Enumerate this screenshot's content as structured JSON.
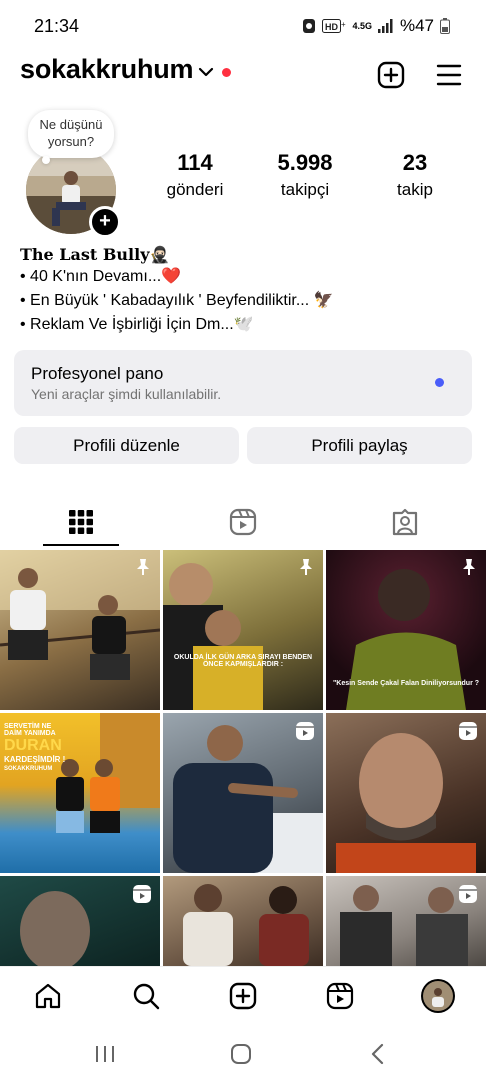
{
  "status": {
    "time": "21:34",
    "signal_label": "4.5G",
    "battery": "%47"
  },
  "header": {
    "username": "sokakkruhum"
  },
  "note": {
    "text_line1": "Ne düşünü",
    "text_line2": "yorsun?"
  },
  "stats": [
    {
      "value": "114",
      "label": "gönderi"
    },
    {
      "value": "5.998",
      "label": "takipçi"
    },
    {
      "value": "23",
      "label": "takip"
    }
  ],
  "bio": {
    "name": "The Last Bully🥷🏻",
    "lines": [
      "• 40 K'nın Devamı...❤️",
      "• En Büyük ' Kabadayılık ' Beyfendiliktir... 🦅",
      "• Reklam Ve İşbirliği İçin Dm...🕊️"
    ]
  },
  "pano": {
    "title": "Profesyonel pano",
    "subtitle": "Yeni araçlar şimdi kullanılabilir.",
    "dot_color": "#4a5df9"
  },
  "buttons": {
    "edit": "Profili düzenle",
    "share": "Profili paylaş"
  },
  "grid": {
    "captions": {
      "post2_line1": "OKULDA İLK GÜN ARKA SIRAYI BENDEN",
      "post2_line2": "ÖNCE KAPMIŞLARDIR :",
      "post3": "\"Kesin Sende Çakal Falan Diniliyorsundur ?",
      "post4_line1": "SERVETİM NE",
      "post4_line2": "DAİM YANIMDA",
      "post4_line3": "DURAN",
      "post4_line4": "KARDEŞİMDİR !",
      "post4_line5": "SOKAKKRUHUM"
    }
  },
  "colors": {
    "accent_red": "#ff3040",
    "surface": "#efeff2"
  }
}
